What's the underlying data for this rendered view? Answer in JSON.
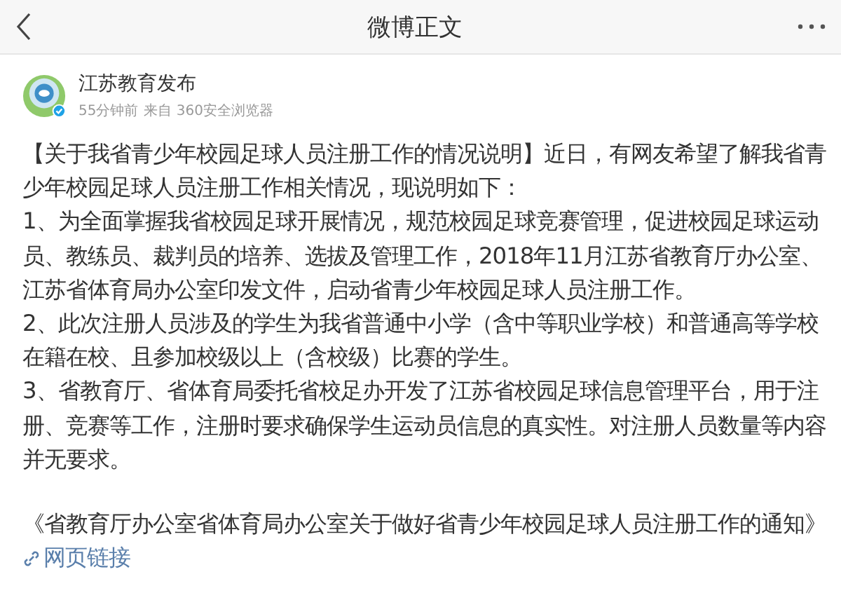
{
  "header": {
    "title": "微博正文"
  },
  "author": {
    "name": "江苏教育发布",
    "time": "55分钟前",
    "source": "来自 360安全浏览器"
  },
  "paragraphs": [
    "【关于我省青少年校园足球人员注册工作的情况说明】近日，有网友希望了解我省青少年校园足球人员注册工作相关情况，现说明如下：",
    "1、为全面掌握我省校园足球开展情况，规范校园足球竞赛管理，促进校园足球运动员、教练员、裁判员的培养、选拔及管理工作，2018年11月江苏省教育厅办公室、江苏省体育局办公室印发文件，启动省青少年校园足球人员注册工作。",
    "2、此次注册人员涉及的学生为我省普通中小学（含中等职业学校）和普通高等学校在籍在校、且参加校级以上（含校级）比赛的学生。",
    "3、省教育厅、省体育局委托省校足办开发了江苏省校园足球信息管理平台，用于注册、竞赛等工作，注册时要求确保学生运动员信息的真实性。对注册人员数量等内容并无要求。"
  ],
  "notice": {
    "text": "《省教育厅办公室省体育局办公室关于做好省青少年校园足球人员注册工作的通知》",
    "link": "网页链接"
  }
}
